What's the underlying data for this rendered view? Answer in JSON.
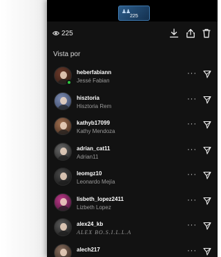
{
  "story": {
    "thumb_count": "225"
  },
  "header": {
    "views_count": "225"
  },
  "section": {
    "title": "Vista por"
  },
  "colors": {
    "online": "#2ecc40",
    "panel_bg": "#121212",
    "accent": "#2d5d8a"
  },
  "viewers": [
    {
      "username": "heberfabiann",
      "name": "Jessé Fabian",
      "avatar": [
        "#6b3a2a",
        "#2b1a14"
      ],
      "online": true
    },
    {
      "username": "hisztoria",
      "name": "Hisztoria Rem",
      "avatar": [
        "#7d8cb3",
        "#33405e"
      ],
      "online": false
    },
    {
      "username": "kathyb17099",
      "name": "Kathy Mendoza",
      "avatar": [
        "#a07050",
        "#3a241a"
      ],
      "online": false
    },
    {
      "username": "adrian_cat11",
      "name": "Adrian11",
      "avatar": [
        "#6a6a6a",
        "#1c1c1c"
      ],
      "online": false
    },
    {
      "username": "leomgz10",
      "name": "Leonardo Mejía",
      "avatar": [
        "#4a4a4a",
        "#101010"
      ],
      "online": false
    },
    {
      "username": "lisbeth_lopez2411",
      "name": "Lizbeth Lopez",
      "avatar": [
        "#c03a8a",
        "#3a1030"
      ],
      "online": false
    },
    {
      "username": "alex24_kb",
      "name": "ALEX BO.S.I.L.L.A",
      "avatar": [
        "#5a5a5a",
        "#151515"
      ],
      "online": false,
      "fancy": true
    },
    {
      "username": "alech217",
      "name": "",
      "avatar": [
        "#8a7060",
        "#2a1f18"
      ],
      "online": false
    }
  ]
}
